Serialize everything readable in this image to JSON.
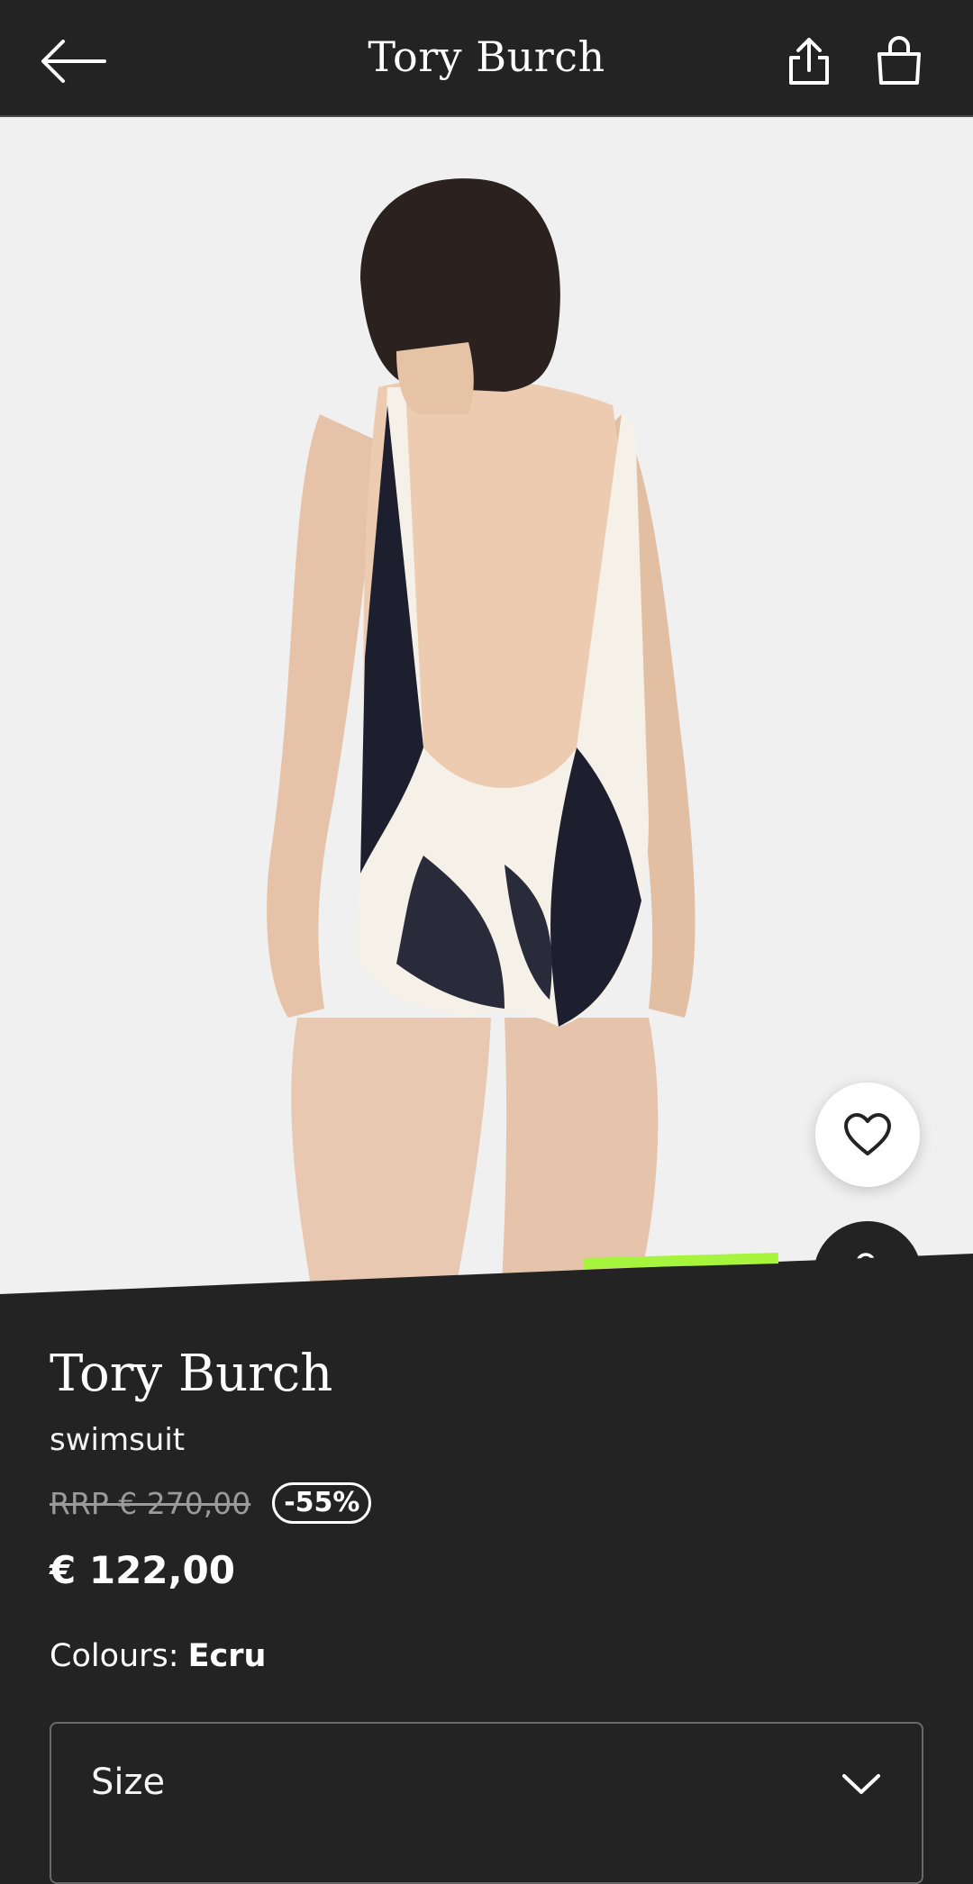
{
  "header": {
    "title": "Tory Burch",
    "back_icon": "arrow-left-icon",
    "share_icon": "share-icon",
    "bag_icon": "shopping-bag-icon"
  },
  "media": {
    "image": "model wearing printed one-piece swimsuit, back view",
    "gallery_progress": 0.25,
    "accent_color": "#a6f43b"
  },
  "actions": {
    "wishlist_icon": "heart-icon",
    "add_to_bag_icon": "bag-plus-icon"
  },
  "product": {
    "brand": "Tory Burch",
    "name": "swimsuit",
    "rrp": "RRP € 270,00",
    "discount": "-55%",
    "price": "€ 122,00",
    "colours_label": "Colours:",
    "colour_value": "Ecru"
  },
  "size_select": {
    "label": "Size",
    "icon": "chevron-down-icon"
  }
}
